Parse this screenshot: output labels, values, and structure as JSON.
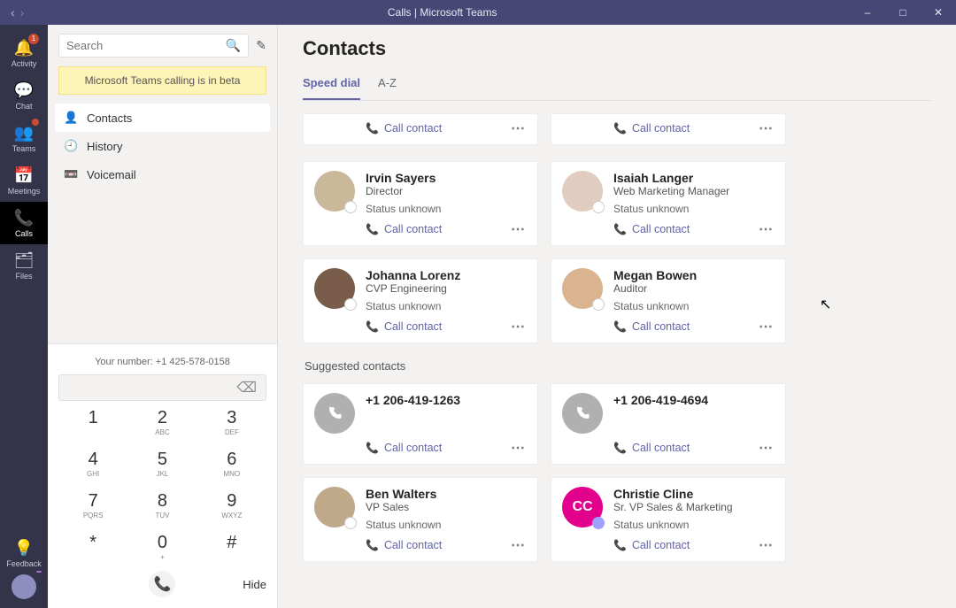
{
  "window": {
    "title": "Calls | Microsoft Teams"
  },
  "rail": {
    "items": [
      {
        "icon": "🔔",
        "label": "Activity",
        "badge": "1"
      },
      {
        "icon": "💬",
        "label": "Chat",
        "badge": ""
      },
      {
        "icon": "👥",
        "label": "Teams",
        "badge": "•"
      },
      {
        "icon": "📅",
        "label": "Meetings",
        "badge": ""
      },
      {
        "icon": "📞",
        "label": "Calls",
        "badge": ""
      },
      {
        "icon": "🗂",
        "label": "Files",
        "badge": ""
      }
    ],
    "feedback": {
      "icon": "💡",
      "label": "Feedback"
    }
  },
  "panel": {
    "search_placeholder": "Search",
    "beta_notice": "Microsoft Teams calling is in beta",
    "nav": [
      {
        "icon": "👤",
        "label": "Contacts"
      },
      {
        "icon": "🕘",
        "label": "History"
      },
      {
        "icon": "📼",
        "label": "Voicemail"
      }
    ],
    "your_number_label": "Your number: +1 425-578-0158",
    "dialpad": [
      {
        "d": "1",
        "l": ""
      },
      {
        "d": "2",
        "l": "ABC"
      },
      {
        "d": "3",
        "l": "DEF"
      },
      {
        "d": "4",
        "l": "GHI"
      },
      {
        "d": "5",
        "l": "JKL"
      },
      {
        "d": "6",
        "l": "MNO"
      },
      {
        "d": "7",
        "l": "PQRS"
      },
      {
        "d": "8",
        "l": "TUV"
      },
      {
        "d": "9",
        "l": "WXYZ"
      },
      {
        "d": "*",
        "l": ""
      },
      {
        "d": "0",
        "l": "+"
      },
      {
        "d": "#",
        "l": ""
      }
    ],
    "hide_label": "Hide"
  },
  "main": {
    "heading": "Contacts",
    "tabs": [
      {
        "label": "Speed dial",
        "active": true
      },
      {
        "label": "A-Z",
        "active": false
      }
    ],
    "call_contact_label": "Call contact",
    "speed_dial_stub_rows": 1,
    "speed_dial": [
      {
        "name": "Irvin Sayers",
        "role": "Director",
        "status": "Status unknown",
        "avatar": "#c9b89a",
        "initials": "",
        "presence": "unknown"
      },
      {
        "name": "Isaiah Langer",
        "role": "Web Marketing Manager",
        "status": "Status unknown",
        "avatar": "#e0cdbf",
        "initials": "",
        "presence": "unknown"
      },
      {
        "name": "Johanna Lorenz",
        "role": "CVP Engineering",
        "status": "Status unknown",
        "avatar": "#7a5c4a",
        "initials": "",
        "presence": "unknown"
      },
      {
        "name": "Megan Bowen",
        "role": "Auditor",
        "status": "Status unknown",
        "avatar": "#d9b48f",
        "initials": "",
        "presence": "unknown"
      }
    ],
    "suggested_label": "Suggested contacts",
    "suggested": [
      {
        "name": "+1 206-419-1263",
        "role": "",
        "status": "",
        "avatar": "phone",
        "presence": ""
      },
      {
        "name": "+1 206-419-4694",
        "role": "",
        "status": "",
        "avatar": "phone",
        "presence": ""
      },
      {
        "name": "Ben Walters",
        "role": "VP Sales",
        "status": "Status unknown",
        "avatar": "#bfa98a",
        "initials": "",
        "presence": "unknown"
      },
      {
        "name": "Christie Cline",
        "role": "Sr. VP Sales & Marketing",
        "status": "Status unknown",
        "avatar": "#e3008c",
        "initials": "CC",
        "presence": "suggested"
      }
    ]
  }
}
